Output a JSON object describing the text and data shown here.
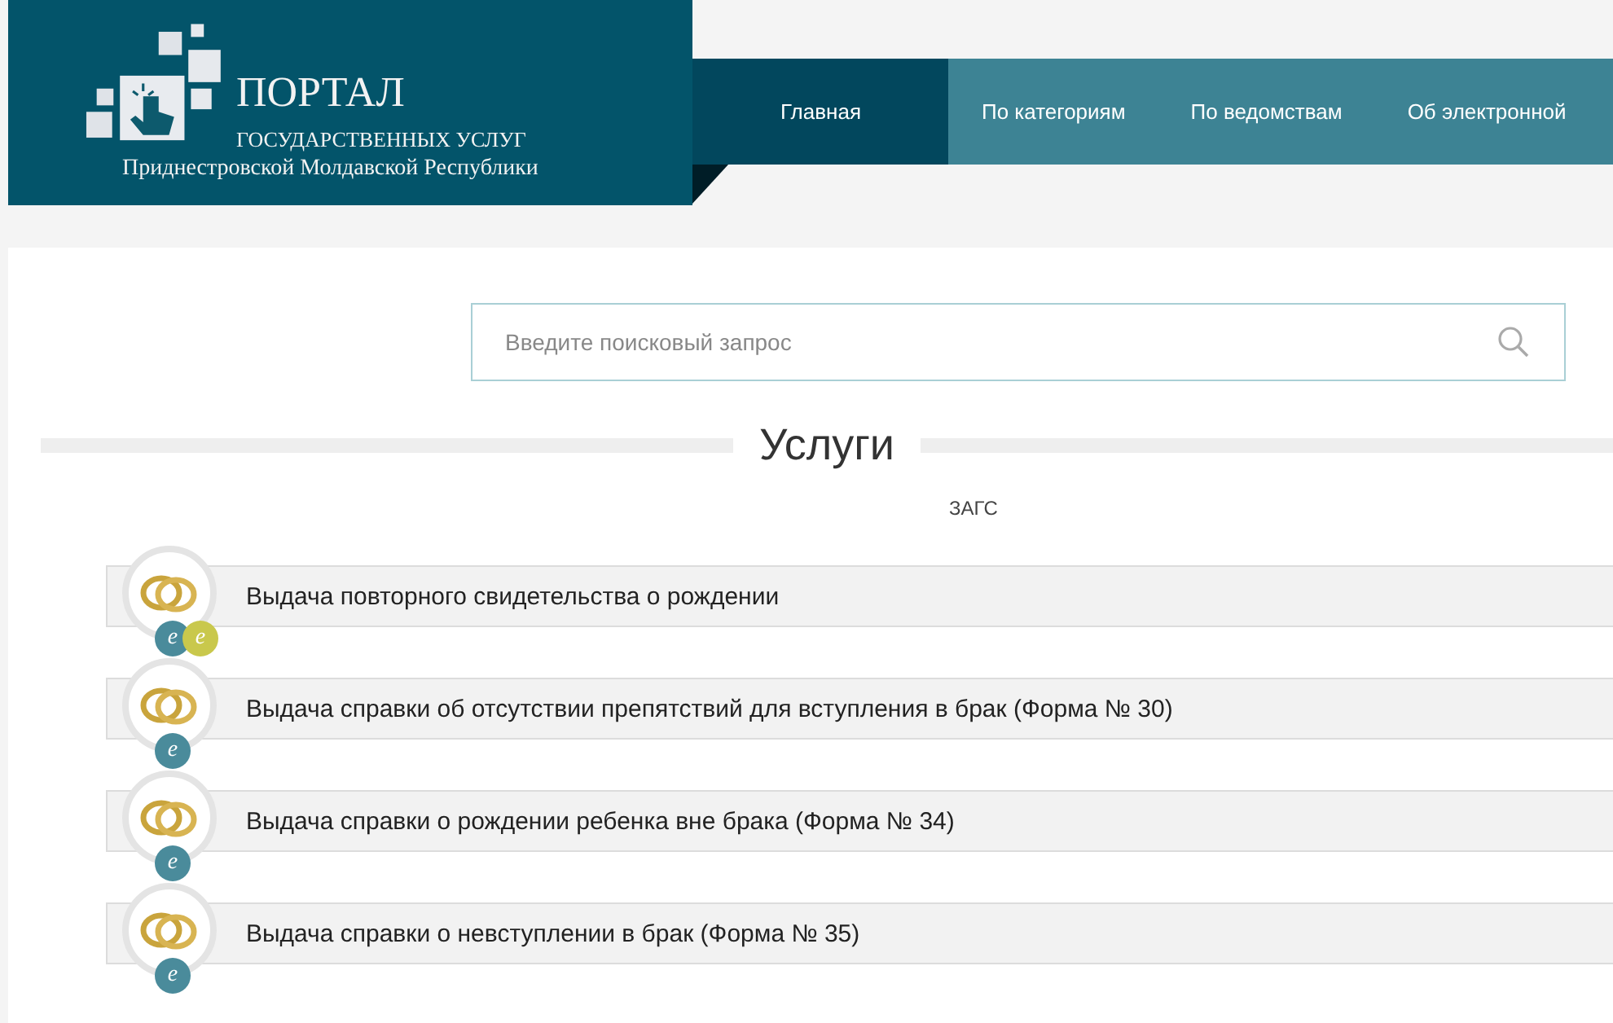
{
  "logo": {
    "title": "ПОРТАЛ",
    "subtitle": "ГОСУДАРСТВЕННЫХ УСЛУГ",
    "region": "Приднестровской Молдавской Республики"
  },
  "nav": [
    {
      "label": "Главная",
      "selected": true
    },
    {
      "label": "По категориям",
      "selected": false
    },
    {
      "label": "По ведомствам",
      "selected": false
    },
    {
      "label": "Об электронной",
      "selected": false
    }
  ],
  "search": {
    "placeholder": "Введите поисковый запрос"
  },
  "heading": "Услуги",
  "category": "ЗАГС",
  "services": [
    {
      "title": "Выдача повторного свидетельства о рождении",
      "badges": [
        {
          "letter": "e",
          "color": "#4a8b9b"
        },
        {
          "letter": "e",
          "color": "#c9c84c"
        }
      ]
    },
    {
      "title": "Выдача справки об отсутствии препятствий для вступления в брак (Форма № 30)",
      "badges": [
        {
          "letter": "e",
          "color": "#4a8b9b"
        }
      ]
    },
    {
      "title": "Выдача справки о рождении ребенка вне брака (Форма № 34)",
      "badges": [
        {
          "letter": "e",
          "color": "#4a8b9b"
        }
      ]
    },
    {
      "title": "Выдача справки о невступлении в брак (Форма № 35)",
      "badges": [
        {
          "letter": "e",
          "color": "#4a8b9b"
        }
      ]
    }
  ]
}
